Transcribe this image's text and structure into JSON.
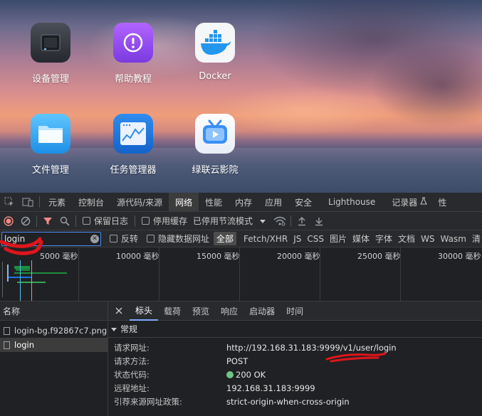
{
  "desktop": {
    "apps": [
      {
        "label": "设备管理",
        "icon": "nas-device-icon"
      },
      {
        "label": "帮助教程",
        "icon": "help-tutorial-icon"
      },
      {
        "label": "Docker",
        "icon": "docker-whale-icon"
      },
      {
        "label": "文件管理",
        "icon": "folder-icon"
      },
      {
        "label": "任务管理器",
        "icon": "task-manager-chart-icon"
      },
      {
        "label": "绿联云影院",
        "icon": "tv-video-icon"
      }
    ]
  },
  "devtools": {
    "tabs": [
      "元素",
      "控制台",
      "源代码/来源",
      "网络",
      "性能",
      "内存",
      "应用",
      "安全",
      "Lighthouse",
      "记录器",
      "性"
    ],
    "active_tab": "网络",
    "toolbar": {
      "preserve_log": "保留日志",
      "disable_cache": "停用缓存",
      "throttle": "已停用节流模式"
    },
    "filter": {
      "value": "login",
      "invert": "反转",
      "hide_data_urls": "隐藏数据网址",
      "types": [
        "全部",
        "Fetch/XHR",
        "JS",
        "CSS",
        "图片",
        "媒体",
        "字体",
        "文档",
        "WS",
        "Wasm",
        "清"
      ],
      "selected_type": "全部"
    },
    "timeline": {
      "ticks": [
        "5000 毫秒",
        "10000 毫秒",
        "15000 毫秒",
        "20000 毫秒",
        "25000 毫秒",
        "30000 毫秒"
      ]
    },
    "requests": {
      "header": "名称",
      "items": [
        "login-bg.f92867c7.png",
        "login"
      ],
      "selected": "login"
    },
    "detail": {
      "tabs": [
        "标头",
        "载荷",
        "预览",
        "响应",
        "启动器",
        "时间"
      ],
      "active_tab": "标头",
      "section_title": "常规",
      "general": [
        {
          "key": "请求网址:",
          "value": "http://192.168.31.183:9999/v1/user/login"
        },
        {
          "key": "请求方法:",
          "value": "POST"
        },
        {
          "key": "状态代码:",
          "value": "200 OK"
        },
        {
          "key": "远程地址:",
          "value": "192.168.31.183:9999"
        },
        {
          "key": "引荐来源网址政策:",
          "value": "strict-origin-when-cross-origin"
        }
      ]
    }
  },
  "colors": {
    "devtools_bg": "#202124",
    "panel_bg": "#292a2d",
    "accent": "#4a8af4",
    "record": "#f28b82",
    "status_ok": "#6fc486",
    "annotation_red": "#e0151b"
  }
}
